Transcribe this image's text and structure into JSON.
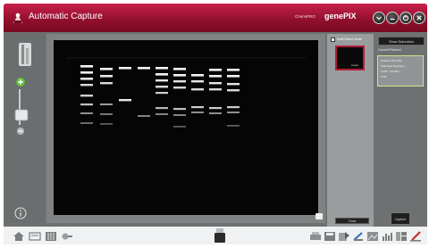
{
  "titlebar": {
    "title": "Automatic Capture",
    "brand_sub": "ChemiPRO",
    "brand_main": "genePIX"
  },
  "thumbnails": {
    "multi_select_label": "Multi Select Mode",
    "thumb_caption": "Image1",
    "close_label": "Close"
  },
  "right_panel": {
    "show_saturation_label": "Show Saturation",
    "current_protocol_label": "Current Protocol",
    "protocol_lines": [
      "Ethidium Bromide",
      "Automatic Exposure",
      "FLAB - Gel Box",
      "UVB"
    ],
    "capture_label": "Capture"
  },
  "colors": {
    "titlebar": "#a3153a",
    "accent_green": "#5fbf3a",
    "protocol_border": "#d7e08a"
  }
}
